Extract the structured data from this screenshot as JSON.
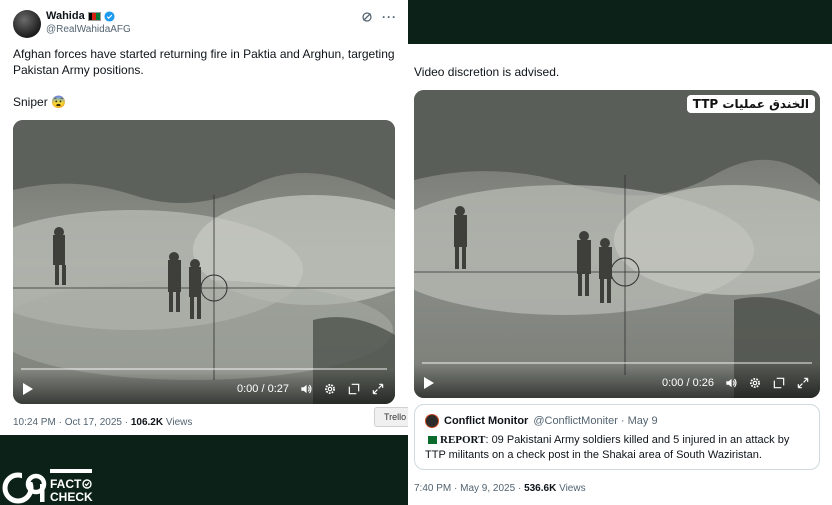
{
  "left_tweet": {
    "display_name": "Wahida",
    "handle": "@RealWahidaAFG",
    "text_line1": "Afghan forces have started returning fire in Paktia and Arghun, targeting Pakistan Army positions.",
    "text_line2": "Sniper 😨",
    "video": {
      "time": "0:00 / 0:27",
      "progress": 0
    },
    "timestamp": "10:24 PM · Oct 17, 2025 · ",
    "views_count": "106.2K",
    "views_label": " Views",
    "tooltip": "Trello"
  },
  "right_tweet": {
    "text": "Video discretion is advised.",
    "video": {
      "time": "0:00 / 0:26",
      "progress": 0,
      "badge": "TTP الخندق عملیات"
    },
    "quote": {
      "name": "Conflict Monitor",
      "handle": "@ConflictMoniter · May 9",
      "report_label": "REPORT",
      "body": ": 09 Pakistani Army soldiers killed and 5 injured in an attack by TTP militants on a check post in the Shakai area of South Waziristan."
    },
    "timestamp": "7:40 PM · May 9, 2025 · ",
    "views_count": "536.6K",
    "views_label": " Views"
  },
  "logo": {
    "line1": "FACT",
    "line2": "CHECK",
    "mark": "C9"
  },
  "icons": {
    "verified": "verified-badge-icon",
    "grok": "grok-icon",
    "more": "more-icon",
    "play": "play-icon",
    "volume": "volume-icon",
    "settings": "gear-icon",
    "pip": "pip-icon",
    "fullscreen": "fullscreen-icon"
  },
  "colors": {
    "background": "#0c2218",
    "verified": "#1d9bf0",
    "text_secondary": "#536471"
  }
}
